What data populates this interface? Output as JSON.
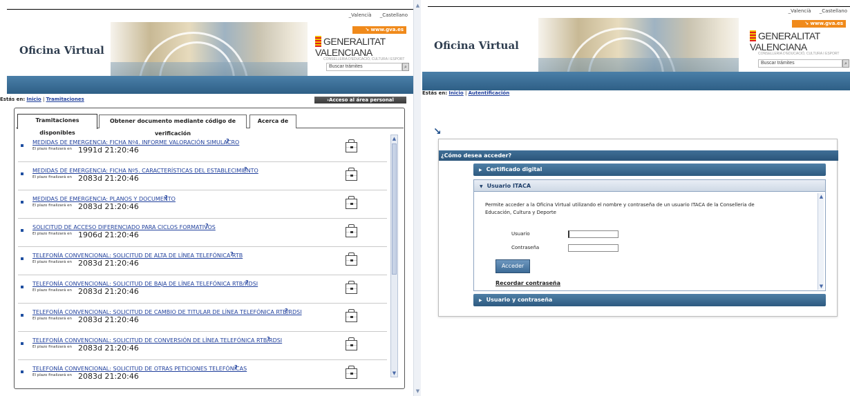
{
  "header": {
    "lang_valenciano": "_Valencià",
    "lang_castellano": "_Castellano",
    "gva_link": "www.gva.es",
    "app_title": "Oficina Virtual",
    "gv_name": "GENERALITAT VALENCIANA",
    "gv_sub": "CONSELLERIA D'EDUCACIÓ, CULTURA I ESPORT",
    "search_placeholder": "Buscar trámites"
  },
  "left": {
    "breadcrumb_label": "Estás en:",
    "breadcrumb_home": "Inicio",
    "breadcrumb_current": "Tramitaciones",
    "access_button": "Acceso al área personal",
    "tabs": [
      {
        "label": "Tramitaciones disponibles"
      },
      {
        "label": "Obtener documento mediante código de verificación"
      },
      {
        "label": "Acerca de"
      }
    ],
    "items": [
      {
        "title": "MEDIDAS DE EMERGENCIA: FICHA Nº4. INFORME VALORACIÓN SIMULACRO",
        "plazo_label": "El plazo finalizará en",
        "plazo_value": "1991d 21:20:46"
      },
      {
        "title": "MEDIDAS DE EMERGENCIA: FICHA Nº5. CARACTERÍSTICAS DEL ESTABLECIMIENTO",
        "plazo_label": "El plazo finalizará en",
        "plazo_value": "2083d 21:20:46"
      },
      {
        "title": "MEDIDAS DE EMERGENCIA: PLANOS Y DOCUMENTO",
        "plazo_label": "El plazo finalizará en",
        "plazo_value": "2083d 21:20:46"
      },
      {
        "title": "SOLICITUD DE ACCESO DIFERENCIADO PARA CICLOS FORMATIVOS",
        "plazo_label": "El plazo finalizará en",
        "plazo_value": "1906d 21:20:46"
      },
      {
        "title": "TELEFONÍA CONVENCIONAL: SOLICITUD DE ALTA DE LÍNEA TELEFÓNICA RTB",
        "plazo_label": "El plazo finalizará en",
        "plazo_value": "2083d 21:20:46"
      },
      {
        "title": "TELEFONÍA CONVENCIONAL: SOLICITUD DE BAJA DE LÍNEA TELEFÓNICA RTB/RDSI",
        "plazo_label": "El plazo finalizará en",
        "plazo_value": "2083d 21:20:46"
      },
      {
        "title": "TELEFONÍA CONVENCIONAL: SOLICITUD DE CAMBIO DE TITULAR DE LÍNEA TELEFÓNICA RTB/RDSI",
        "plazo_label": "El plazo finalizará en",
        "plazo_value": "2083d 21:20:46"
      },
      {
        "title": "TELEFONÍA CONVENCIONAL: SOLICITUD DE CONVERSIÓN DE LÍNEA TELEFÓNICA RTB/RDSI",
        "plazo_label": "El plazo finalizará en",
        "plazo_value": "2083d 21:20:46"
      },
      {
        "title": "TELEFONÍA CONVENCIONAL: SOLICITUD DE OTRAS PETICIONES TELEFÓNICAS",
        "plazo_label": "El plazo finalizará en",
        "plazo_value": "2083d 21:20:46"
      }
    ],
    "help_mark": "?"
  },
  "right": {
    "breadcrumb_label": "Estás en:",
    "breadcrumb_home": "Inicio",
    "breadcrumb_current": "Autentificación",
    "panel_title": "¿Cómo desea acceder?",
    "acc_certificado": "Certificado digital",
    "acc_itaca": "Usuario ITACA",
    "itaca_desc": "Permite acceder a la Oficina Virtual utilizando el nombre y contraseña de un usuario ITACA de la Conselleria de Educación, Cultura y Deporte",
    "usuario_label": "Usuario",
    "password_label": "Contraseña",
    "acceder_button": "Acceder",
    "recordar_link": "Recordar contraseña",
    "acc_userpass": "Usuario y contraseña"
  },
  "colors": {
    "accent_blue": "#2e5f86",
    "orange": "#f08a1b",
    "link": "#1f3f9c"
  }
}
